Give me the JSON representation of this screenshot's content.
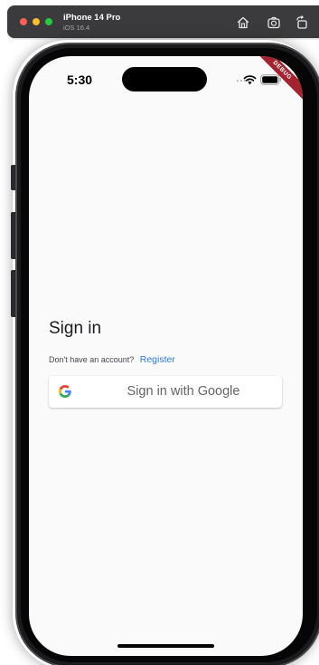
{
  "simulator": {
    "device_name": "iPhone 14 Pro",
    "os_version": "iOS 16.4",
    "toolbar": {
      "home_icon": "home-icon",
      "screenshot_icon": "screenshot-icon",
      "rotate_icon": "rotate-icon"
    }
  },
  "status_bar": {
    "time": "5:30",
    "icons": [
      "signal-dots-icon",
      "wifi-icon",
      "battery-icon"
    ]
  },
  "debug_banner": "DEBUG",
  "signin": {
    "title": "Sign in",
    "register_prompt": "Don't have an account?",
    "register_link": "Register",
    "google_button_label": "Sign in with Google",
    "google_icon": "google-logo-icon"
  },
  "colors": {
    "link": "#2a7de1",
    "debug_ribbon": "#a3242e",
    "screen_background": "#fafafa"
  }
}
